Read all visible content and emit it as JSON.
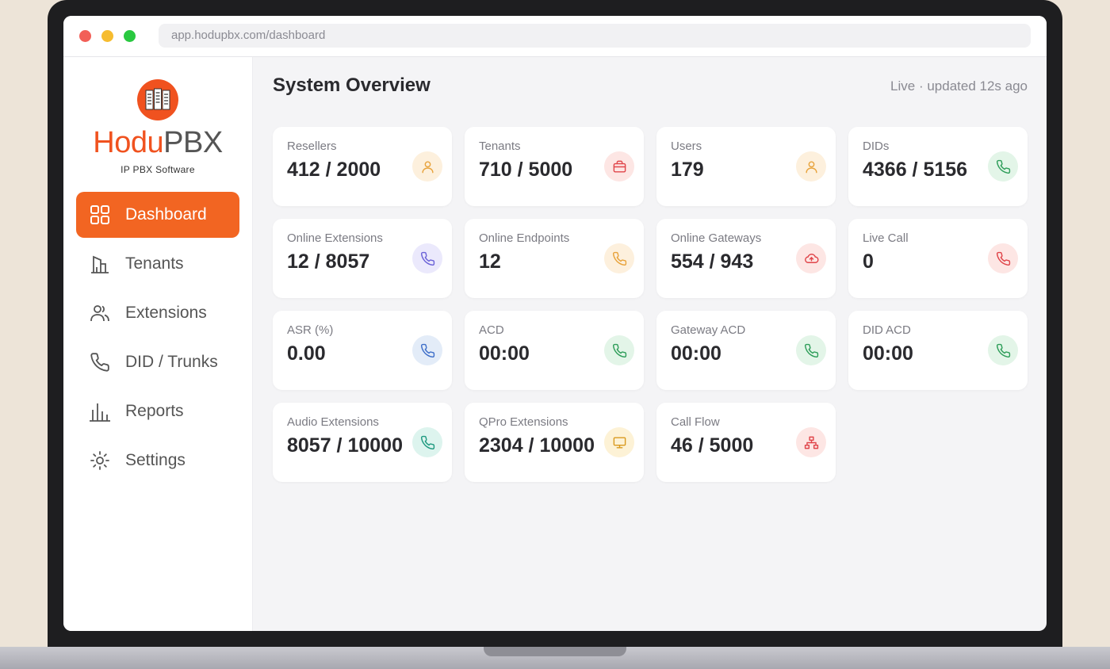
{
  "browser": {
    "url": "app.hodupbx.com/dashboard"
  },
  "brand": {
    "name_part1": "Hodu",
    "name_part2": "PBX",
    "tagline": "IP PBX Software",
    "color": "#f0521f"
  },
  "sidebar": {
    "items": [
      {
        "label": "Dashboard",
        "icon": "grid-icon",
        "active": true
      },
      {
        "label": "Tenants",
        "icon": "building-icon",
        "active": false
      },
      {
        "label": "Extensions",
        "icon": "users-icon",
        "active": false
      },
      {
        "label": "DID / Trunks",
        "icon": "phone-icon",
        "active": false
      },
      {
        "label": "Reports",
        "icon": "bar-chart-icon",
        "active": false
      },
      {
        "label": "Settings",
        "icon": "gear-icon",
        "active": false
      }
    ]
  },
  "header": {
    "title": "System Overview",
    "status": "Live · updated 12s ago"
  },
  "cards": [
    {
      "label": "Resellers",
      "value": "412 / 2000",
      "icon": "user-icon",
      "icon_color": "#e8a33c",
      "icon_bg": "#fdf0dd"
    },
    {
      "label": "Tenants",
      "value": "710 / 5000",
      "icon": "briefcase-icon",
      "icon_color": "#e0454a",
      "icon_bg": "#fde6e4"
    },
    {
      "label": "Users",
      "value": "179",
      "icon": "user-icon",
      "icon_color": "#e8a33c",
      "icon_bg": "#fdf0dd"
    },
    {
      "label": "DIDs",
      "value": "4366 / 5156",
      "icon": "phone-icon",
      "icon_color": "#2f9e5a",
      "icon_bg": "#e3f5e8"
    },
    {
      "label": "Online Extensions",
      "value": "12 / 8057",
      "icon": "phone-icon",
      "icon_color": "#6c63d8",
      "icon_bg": "#ebe9fc"
    },
    {
      "label": "Online Endpoints",
      "value": "12",
      "icon": "phone-icon",
      "icon_color": "#e8a33c",
      "icon_bg": "#fdf0dd"
    },
    {
      "label": "Online Gateways",
      "value": "554 / 943",
      "icon": "cloud-upload-icon",
      "icon_color": "#e0454a",
      "icon_bg": "#fde6e4"
    },
    {
      "label": "Live Call",
      "value": "0",
      "icon": "phone-icon",
      "icon_color": "#e0454a",
      "icon_bg": "#fde6e4"
    },
    {
      "label": "ASR (%)",
      "value": "0.00",
      "icon": "phone-icon",
      "icon_color": "#3f6fc9",
      "icon_bg": "#e3ecf8"
    },
    {
      "label": "ACD",
      "value": "00:00",
      "icon": "phone-icon",
      "icon_color": "#2f9e5a",
      "icon_bg": "#e3f5e8"
    },
    {
      "label": "Gateway ACD",
      "value": "00:00",
      "icon": "phone-icon",
      "icon_color": "#2f9e5a",
      "icon_bg": "#e3f5e8"
    },
    {
      "label": "DID ACD",
      "value": "00:00",
      "icon": "phone-icon",
      "icon_color": "#2f9e5a",
      "icon_bg": "#e3f5e8"
    },
    {
      "label": "Audio Extensions",
      "value": "8057 / 10000",
      "icon": "phone-icon",
      "icon_color": "#1f9a80",
      "icon_bg": "#ddf4ee"
    },
    {
      "label": "QPro Extensions",
      "value": "2304 / 10000",
      "icon": "monitor-icon",
      "icon_color": "#d99a1f",
      "icon_bg": "#fdf2d6"
    },
    {
      "label": "Call Flow",
      "value": "46 / 5000",
      "icon": "sitemap-icon",
      "icon_color": "#e0454a",
      "icon_bg": "#fde6e4"
    }
  ]
}
